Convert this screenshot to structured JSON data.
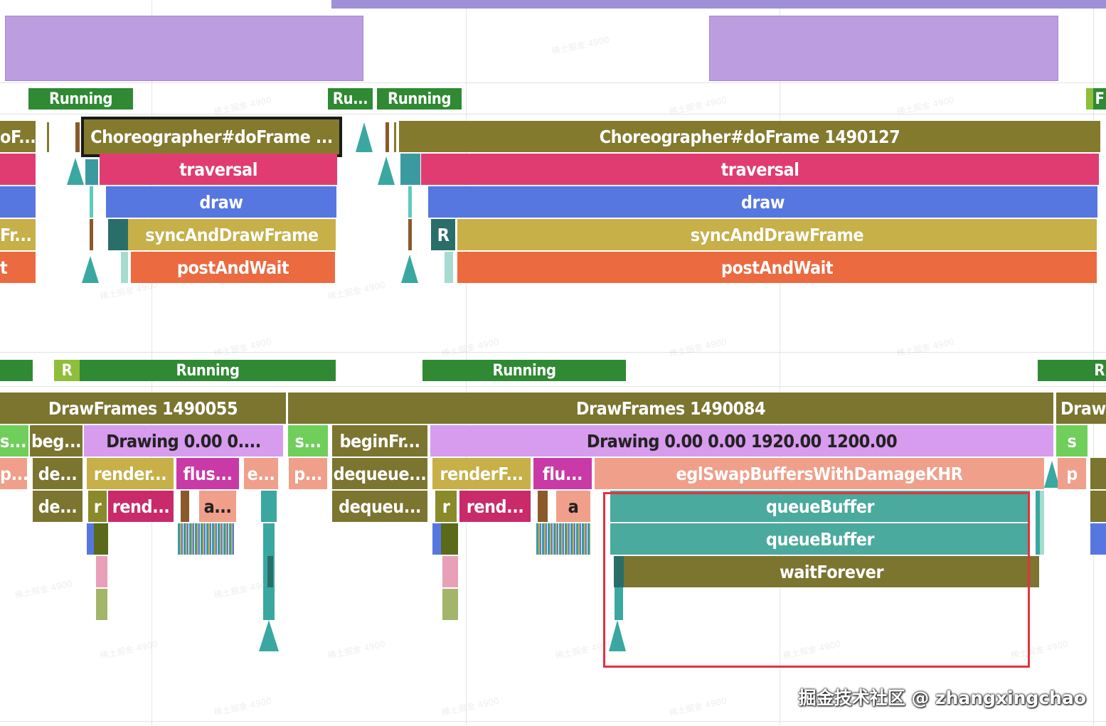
{
  "colors": {
    "cpu_purple": "#bb9de0",
    "running_green": "#2f8a33",
    "runnable_green": "#8fbf3a",
    "choreographer_olive": "#847a2e",
    "traversal_pink": "#e13c72",
    "draw_blue": "#5777e0",
    "sync_mustard": "#c7b048",
    "post_orange": "#ec6a40",
    "drawframes_olive": "#7b7530",
    "drawing_lilac": "#d79cee",
    "egl_salmon": "#f0a08a",
    "queue_teal": "#4aaa9e",
    "flush_magenta": "#c93aa6",
    "highlight_red": "#e5323e"
  },
  "ui_thread": {
    "states": [
      {
        "label": "Running"
      },
      {
        "label": "Ru..."
      },
      {
        "label": "Running"
      },
      {
        "label": "F"
      }
    ],
    "frame1": {
      "choreographer": "Choreographer#doFrame ...",
      "traversal": "traversal",
      "draw": "draw",
      "sync": "syncAndDrawFrame",
      "post": "postAndWait"
    },
    "frame2": {
      "choreographer": "Choreographer#doFrame 1490127",
      "traversal": "traversal",
      "draw": "draw",
      "sync_marker": "R",
      "sync": "syncAndDrawFrame",
      "post": "postAndWait"
    },
    "left_clipped": {
      "row1": "oF...",
      "row4": "Fr...",
      "row5": "t"
    }
  },
  "render_thread": {
    "states": [
      {
        "label": "R"
      },
      {
        "label": "Running"
      },
      {
        "label": "Running"
      },
      {
        "label": "R"
      }
    ],
    "frame1": {
      "drawframes": "DrawFrames 1490055",
      "s": "s...",
      "begin": "beg...",
      "drawing": "Drawing  0.00  0....",
      "p": "p...",
      "de1": "de...",
      "render": "render...",
      "flush": "flus...",
      "e": "e...",
      "de2": "de...",
      "r": "r",
      "rend": "rend...",
      "a": "a..."
    },
    "frame2": {
      "drawframes": "DrawFrames 1490084",
      "s": "s...",
      "begin": "beginFr...",
      "drawing": "Drawing  0.00  0.00 1920.00 1200.00",
      "p": "p...",
      "dequeue1": "dequeue...",
      "renderF": "renderF...",
      "flu": "flu...",
      "egl": "eglSwapBuffersWithDamageKHR",
      "dequeue2": "dequeu...",
      "r": "r",
      "rend": "rend...",
      "a": "a",
      "queue1": "queueBuffer",
      "queue2": "queueBuffer",
      "wait": "waitForever"
    },
    "frame3": {
      "drawframes": "Draw",
      "s": "s",
      "p": "p"
    }
  },
  "watermark": "掘金技术社区 @ zhangxingchao"
}
